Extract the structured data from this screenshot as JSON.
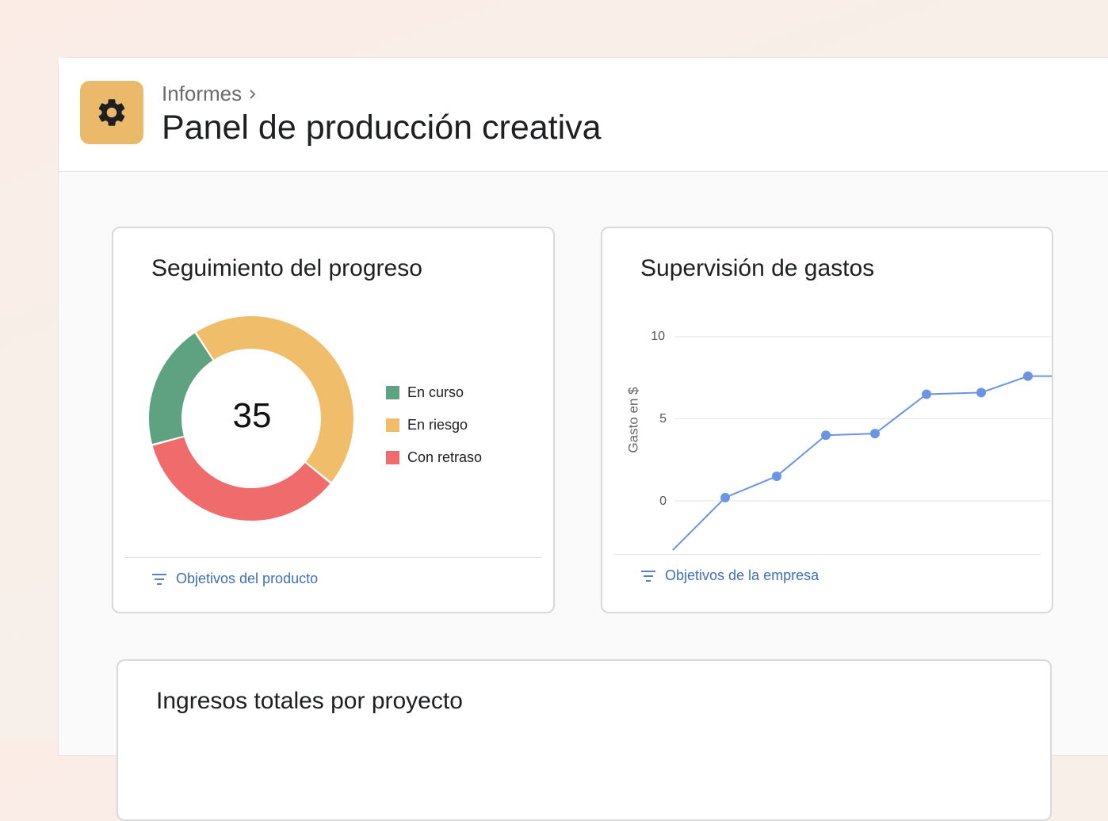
{
  "header": {
    "breadcrumb": "Informes",
    "title": "Panel de producción creativa",
    "icon": "gear-icon",
    "icon_color": "#eab969"
  },
  "progress_card": {
    "title": "Seguimiento del progreso",
    "center_value": "35",
    "legend": [
      {
        "label": "En curso",
        "color": "#5ea282"
      },
      {
        "label": "En riesgo",
        "color": "#f0bd6b"
      },
      {
        "label": "Con retraso",
        "color": "#f06b6b"
      }
    ],
    "footer_link": "Objetivos del producto",
    "footer_icon": "filter-icon"
  },
  "expense_card": {
    "title": "Supervisión de gastos",
    "ylabel": "Gasto en $",
    "yticks": [
      "10",
      "5",
      "0"
    ],
    "footer_link": "Objetivos de la empresa",
    "footer_icon": "filter-icon"
  },
  "revenue_card": {
    "title": "Ingresos totales por proyecto"
  },
  "chart_data": [
    {
      "type": "pie",
      "categories": [
        "En curso",
        "En riesgo",
        "Con retraso"
      ],
      "values": [
        20,
        45,
        35
      ],
      "colors": [
        "#5ea282",
        "#f0bd6b",
        "#f06b6b"
      ]
    },
    {
      "type": "line",
      "ylabel": "Gasto en $",
      "ylim": [
        -3,
        10
      ],
      "x": [
        0,
        1,
        2,
        3,
        4,
        5,
        6,
        7
      ],
      "values": [
        -3,
        0.2,
        1.5,
        4.0,
        4.1,
        6.5,
        6.6,
        7.6
      ],
      "markers": [
        false,
        true,
        true,
        true,
        true,
        true,
        true,
        true
      ],
      "color": "#6b95e2",
      "grid": true
    }
  ]
}
